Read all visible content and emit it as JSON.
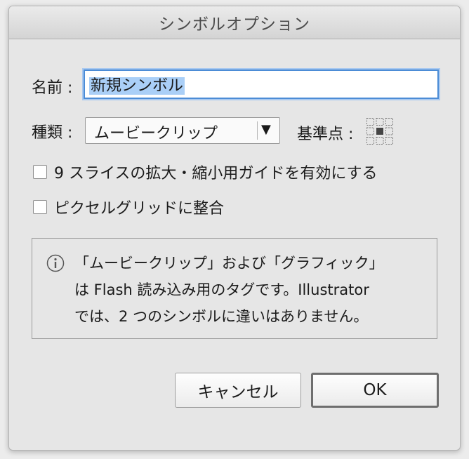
{
  "window": {
    "title": "シンボルオプション"
  },
  "name_field": {
    "label": "名前 :",
    "value": "新規シンボル"
  },
  "type_field": {
    "label": "種類 :",
    "value": "ムービークリップ",
    "arrow": "▼"
  },
  "registration": {
    "label": "基準点 :"
  },
  "checkboxes": [
    {
      "label": "9 スライスの拡大・縮小用ガイドを有効にする",
      "checked": false
    },
    {
      "label": "ピクセルグリッドに整合",
      "checked": false
    }
  ],
  "info": {
    "lines": [
      "「ムービークリップ」および「グラフィック」",
      "は Flash 読み込み用のタグです。Illustrator",
      "では、2 つのシンボルに違いはありません。"
    ]
  },
  "buttons": {
    "cancel": "キャンセル",
    "ok": "OK"
  },
  "colors": {
    "accent": "#4c8cd6",
    "selection": "#aacff7"
  }
}
